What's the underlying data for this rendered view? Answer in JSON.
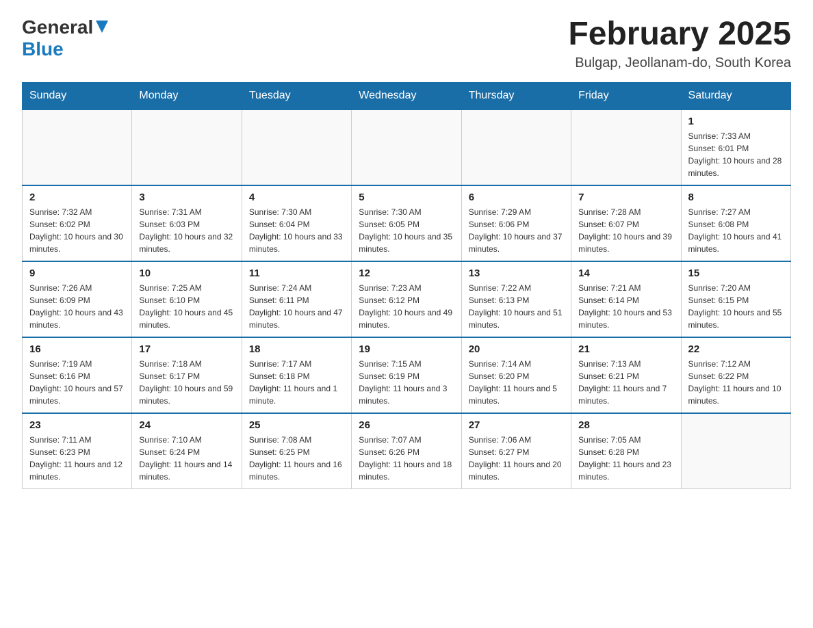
{
  "header": {
    "logo_general": "General",
    "logo_blue": "Blue",
    "month_title": "February 2025",
    "location": "Bulgap, Jeollanam-do, South Korea"
  },
  "days_of_week": [
    "Sunday",
    "Monday",
    "Tuesday",
    "Wednesday",
    "Thursday",
    "Friday",
    "Saturday"
  ],
  "weeks": [
    [
      {
        "day": "",
        "info": ""
      },
      {
        "day": "",
        "info": ""
      },
      {
        "day": "",
        "info": ""
      },
      {
        "day": "",
        "info": ""
      },
      {
        "day": "",
        "info": ""
      },
      {
        "day": "",
        "info": ""
      },
      {
        "day": "1",
        "info": "Sunrise: 7:33 AM\nSunset: 6:01 PM\nDaylight: 10 hours and 28 minutes."
      }
    ],
    [
      {
        "day": "2",
        "info": "Sunrise: 7:32 AM\nSunset: 6:02 PM\nDaylight: 10 hours and 30 minutes."
      },
      {
        "day": "3",
        "info": "Sunrise: 7:31 AM\nSunset: 6:03 PM\nDaylight: 10 hours and 32 minutes."
      },
      {
        "day": "4",
        "info": "Sunrise: 7:30 AM\nSunset: 6:04 PM\nDaylight: 10 hours and 33 minutes."
      },
      {
        "day": "5",
        "info": "Sunrise: 7:30 AM\nSunset: 6:05 PM\nDaylight: 10 hours and 35 minutes."
      },
      {
        "day": "6",
        "info": "Sunrise: 7:29 AM\nSunset: 6:06 PM\nDaylight: 10 hours and 37 minutes."
      },
      {
        "day": "7",
        "info": "Sunrise: 7:28 AM\nSunset: 6:07 PM\nDaylight: 10 hours and 39 minutes."
      },
      {
        "day": "8",
        "info": "Sunrise: 7:27 AM\nSunset: 6:08 PM\nDaylight: 10 hours and 41 minutes."
      }
    ],
    [
      {
        "day": "9",
        "info": "Sunrise: 7:26 AM\nSunset: 6:09 PM\nDaylight: 10 hours and 43 minutes."
      },
      {
        "day": "10",
        "info": "Sunrise: 7:25 AM\nSunset: 6:10 PM\nDaylight: 10 hours and 45 minutes."
      },
      {
        "day": "11",
        "info": "Sunrise: 7:24 AM\nSunset: 6:11 PM\nDaylight: 10 hours and 47 minutes."
      },
      {
        "day": "12",
        "info": "Sunrise: 7:23 AM\nSunset: 6:12 PM\nDaylight: 10 hours and 49 minutes."
      },
      {
        "day": "13",
        "info": "Sunrise: 7:22 AM\nSunset: 6:13 PM\nDaylight: 10 hours and 51 minutes."
      },
      {
        "day": "14",
        "info": "Sunrise: 7:21 AM\nSunset: 6:14 PM\nDaylight: 10 hours and 53 minutes."
      },
      {
        "day": "15",
        "info": "Sunrise: 7:20 AM\nSunset: 6:15 PM\nDaylight: 10 hours and 55 minutes."
      }
    ],
    [
      {
        "day": "16",
        "info": "Sunrise: 7:19 AM\nSunset: 6:16 PM\nDaylight: 10 hours and 57 minutes."
      },
      {
        "day": "17",
        "info": "Sunrise: 7:18 AM\nSunset: 6:17 PM\nDaylight: 10 hours and 59 minutes."
      },
      {
        "day": "18",
        "info": "Sunrise: 7:17 AM\nSunset: 6:18 PM\nDaylight: 11 hours and 1 minute."
      },
      {
        "day": "19",
        "info": "Sunrise: 7:15 AM\nSunset: 6:19 PM\nDaylight: 11 hours and 3 minutes."
      },
      {
        "day": "20",
        "info": "Sunrise: 7:14 AM\nSunset: 6:20 PM\nDaylight: 11 hours and 5 minutes."
      },
      {
        "day": "21",
        "info": "Sunrise: 7:13 AM\nSunset: 6:21 PM\nDaylight: 11 hours and 7 minutes."
      },
      {
        "day": "22",
        "info": "Sunrise: 7:12 AM\nSunset: 6:22 PM\nDaylight: 11 hours and 10 minutes."
      }
    ],
    [
      {
        "day": "23",
        "info": "Sunrise: 7:11 AM\nSunset: 6:23 PM\nDaylight: 11 hours and 12 minutes."
      },
      {
        "day": "24",
        "info": "Sunrise: 7:10 AM\nSunset: 6:24 PM\nDaylight: 11 hours and 14 minutes."
      },
      {
        "day": "25",
        "info": "Sunrise: 7:08 AM\nSunset: 6:25 PM\nDaylight: 11 hours and 16 minutes."
      },
      {
        "day": "26",
        "info": "Sunrise: 7:07 AM\nSunset: 6:26 PM\nDaylight: 11 hours and 18 minutes."
      },
      {
        "day": "27",
        "info": "Sunrise: 7:06 AM\nSunset: 6:27 PM\nDaylight: 11 hours and 20 minutes."
      },
      {
        "day": "28",
        "info": "Sunrise: 7:05 AM\nSunset: 6:28 PM\nDaylight: 11 hours and 23 minutes."
      },
      {
        "day": "",
        "info": ""
      }
    ]
  ]
}
